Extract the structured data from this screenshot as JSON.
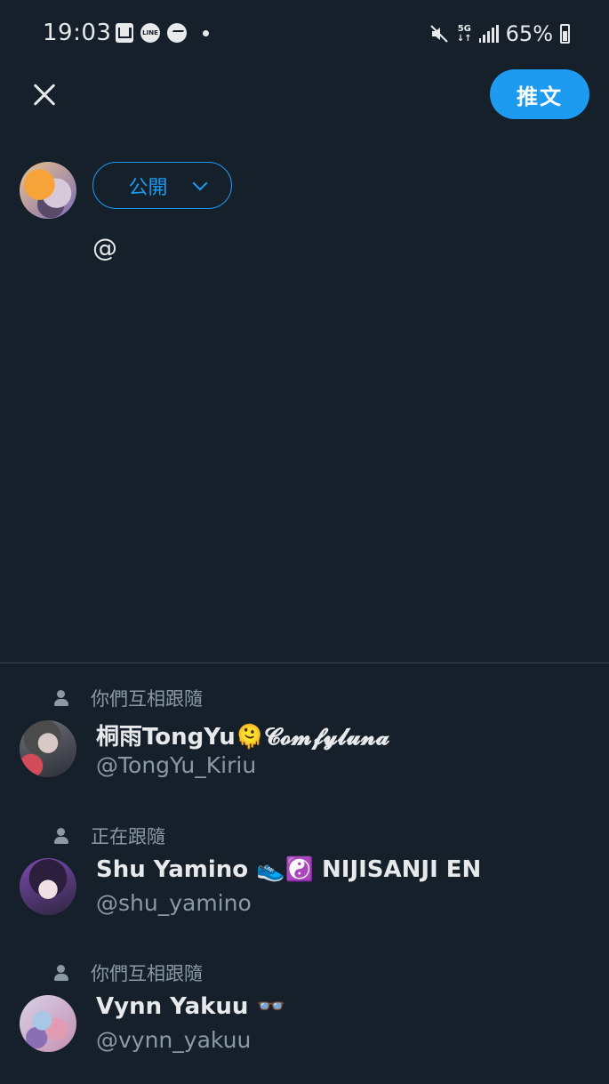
{
  "status_bar": {
    "time": "19:03",
    "network": "5G",
    "battery": "65%"
  },
  "header": {
    "tweet_label": "推文"
  },
  "composer": {
    "audience_label": "公開",
    "text": "@"
  },
  "suggestions": [
    {
      "context": "你們互相跟隨",
      "name": "桐雨TongYu🫠𝓒𝓸𝓶𝓯𝔂𝓵𝓾𝓷𝓪",
      "handle": "@TongYu_Kiriu"
    },
    {
      "context": "正在跟隨",
      "name": "Shu Yamino 👟☯️ NIJISANJI EN",
      "handle": "@shu_yamino"
    },
    {
      "context": "你們互相跟隨",
      "name": "Vynn Yakuu 👓",
      "handle": "@vynn_yakuu"
    }
  ]
}
